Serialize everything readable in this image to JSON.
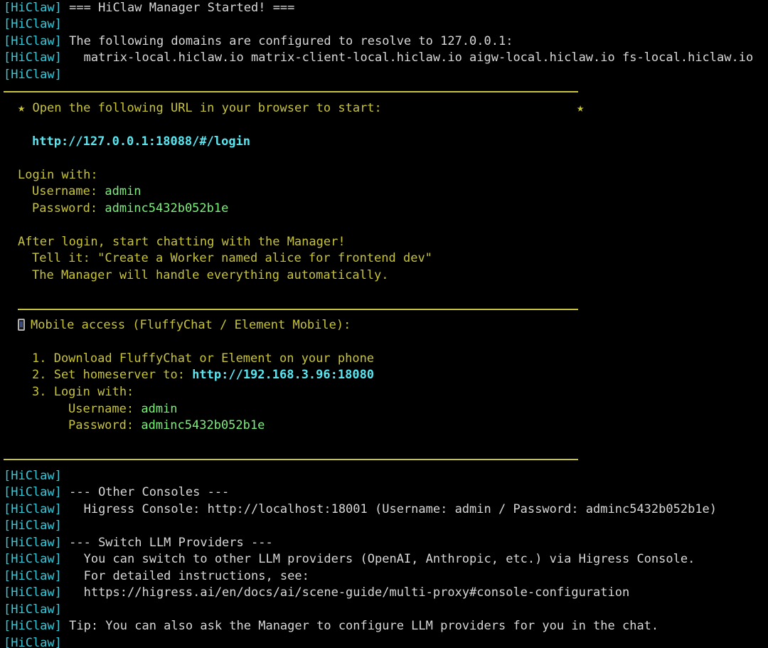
{
  "tag": "[HiClaw]",
  "header": {
    "started": " === HiClaw Manager Started! ===",
    "domains_intro": " The following domains are configured to resolve to 127.0.0.1:",
    "domains_list": "   matrix-local.hiclaw.io matrix-client-local.hiclaw.io aigw-local.hiclaw.io fs-local.hiclaw.io"
  },
  "login_box": {
    "star": "★",
    "open_text": "Open the following URL in your browser to start:",
    "url": "http://127.0.0.1:18088/#/login",
    "login_with": "Login with:",
    "username_label": "Username: ",
    "username_value": "admin",
    "password_label": "Password: ",
    "password_value": "adminc5432b052b1e",
    "after_login": "After login, start chatting with the Manager!",
    "tell_it": "Tell it: \"Create a Worker named alice for frontend dev\"",
    "handle": "The Manager will handle everything automatically."
  },
  "mobile": {
    "icon": "mobile-phone-icon",
    "title": "Mobile access (FluffyChat / Element Mobile):",
    "step1": "1. Download FluffyChat or Element on your phone",
    "step2_label": "2. Set homeserver to: ",
    "step2_url": "http://192.168.3.96:18080",
    "step3": "3. Login with:",
    "username_label": "Username: ",
    "username_value": "admin",
    "password_label": "Password: ",
    "password_value": "adminc5432b052b1e"
  },
  "footer": {
    "other_consoles": " --- Other Consoles ---",
    "higress_console": "   Higress Console: http://localhost:18001 (Username: admin / Password: adminc5432b052b1e)",
    "switch_llm": " --- Switch LLM Providers ---",
    "switch_text": "   You can switch to other LLM providers (OpenAI, Anthropic, etc.) via Higress Console.",
    "instructions": "   For detailed instructions, see:",
    "docs_url": "   https://higress.ai/en/docs/ai/scene-guide/multi-proxy#console-configuration",
    "tip": " Tip: You can also ask the Manager to configure LLM providers for you in the chat."
  },
  "colors": {
    "background": "#000000",
    "tag": "#36c8d8",
    "yellow": "#c8c43a",
    "green": "#7af07a",
    "cyan": "#5ae6f0",
    "text": "#d8d8d8"
  }
}
